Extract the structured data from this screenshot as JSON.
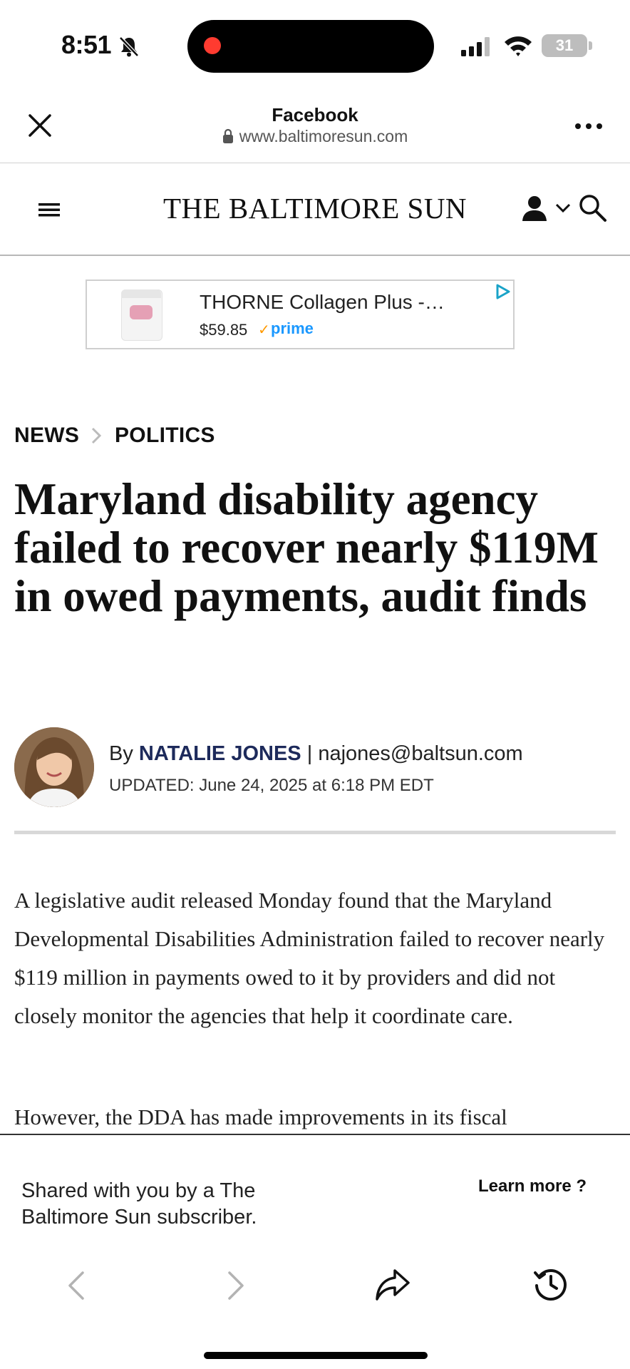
{
  "status_bar": {
    "time": "8:51",
    "battery": "31",
    "icons": [
      "bell-slash-icon",
      "cellular-signal-icon",
      "wifi-icon",
      "battery-icon"
    ]
  },
  "browser": {
    "source_label": "Facebook",
    "url": "www.baltimoresun.com",
    "close_icon": "close-icon",
    "more_icon": "more-icon"
  },
  "site": {
    "masthead": "THE BALTIMORE SUN"
  },
  "ad": {
    "title": "THORNE Collagen Plus -…",
    "price": "$59.85",
    "prime": "prime"
  },
  "breadcrumb": {
    "section": "NEWS",
    "subsection": "POLITICS"
  },
  "article": {
    "headline": "Maryland disability agency failed to recover nearly $119M in owed payments, audit finds",
    "by_prefix": "By",
    "author": "NATALIE JONES",
    "separator": "|",
    "email": "najones@baltsun.com",
    "updated": "UPDATED: June 24, 2025 at 6:18 PM EDT",
    "paragraphs": [
      "A legislative audit released Monday found that the Maryland Developmental Disabilities Administration failed to recover nearly $119 million in payments owed to it by providers and did not closely monitor the agencies that help it coordinate care.",
      "However, the DDA has made improvements in its fiscal"
    ]
  },
  "share_panel": {
    "message": "Shared with you by a The Baltimore Sun subscriber.",
    "learn_more": "Learn more ?"
  },
  "colors": {
    "author_navy": "#1d2a5b",
    "recording_red": "#ff3b30",
    "prime_blue": "#1a98ff"
  }
}
